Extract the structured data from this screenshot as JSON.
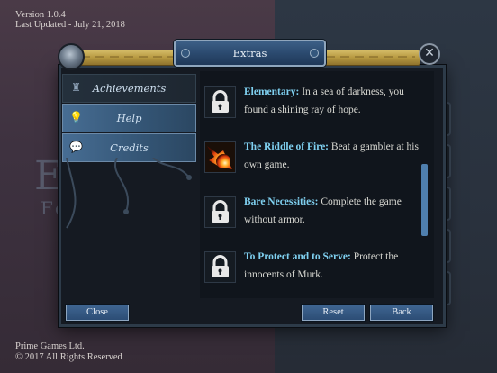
{
  "app": {
    "version": "Version 1.0.4",
    "last_updated": "Last Updated - July 21, 2018",
    "company": "Prime Games Ltd.",
    "copyright": "© 2017 All Rights Reserved"
  },
  "dialog": {
    "title": "Extras",
    "close_glyph": "✕"
  },
  "sidebar": {
    "items": [
      {
        "label": "Achievements",
        "icon": "trophy-icon",
        "icon_glyph": "♜"
      },
      {
        "label": "Help",
        "icon": "lightbulb-icon",
        "icon_glyph": "💡"
      },
      {
        "label": "Credits",
        "icon": "speech-bubble-icon",
        "icon_glyph": "💬"
      }
    ],
    "active_index": 1
  },
  "achievements": [
    {
      "name": "Elementary:",
      "desc": "In a sea of darkness, you found a shining ray of hope.",
      "icon": "lock-icon",
      "unlocked": false
    },
    {
      "name": "The Riddle of Fire:",
      "desc": "Beat a gambler at his own game.",
      "icon": "fireball-icon",
      "unlocked": true
    },
    {
      "name": "Bare Necessities:",
      "desc": "Complete the game without armor.",
      "icon": "lock-icon",
      "unlocked": false
    },
    {
      "name": "To Protect and to Serve:",
      "desc": "Protect the innocents of Murk.",
      "icon": "lock-icon",
      "unlocked": false
    }
  ],
  "buttons": {
    "close": "Close",
    "reset": "Reset",
    "back": "Back"
  },
  "colors": {
    "accent_blue": "#345575",
    "gold_trim": "#b69840",
    "achievement_name": "#7fd0f0",
    "panel_bg": "#151a22"
  }
}
